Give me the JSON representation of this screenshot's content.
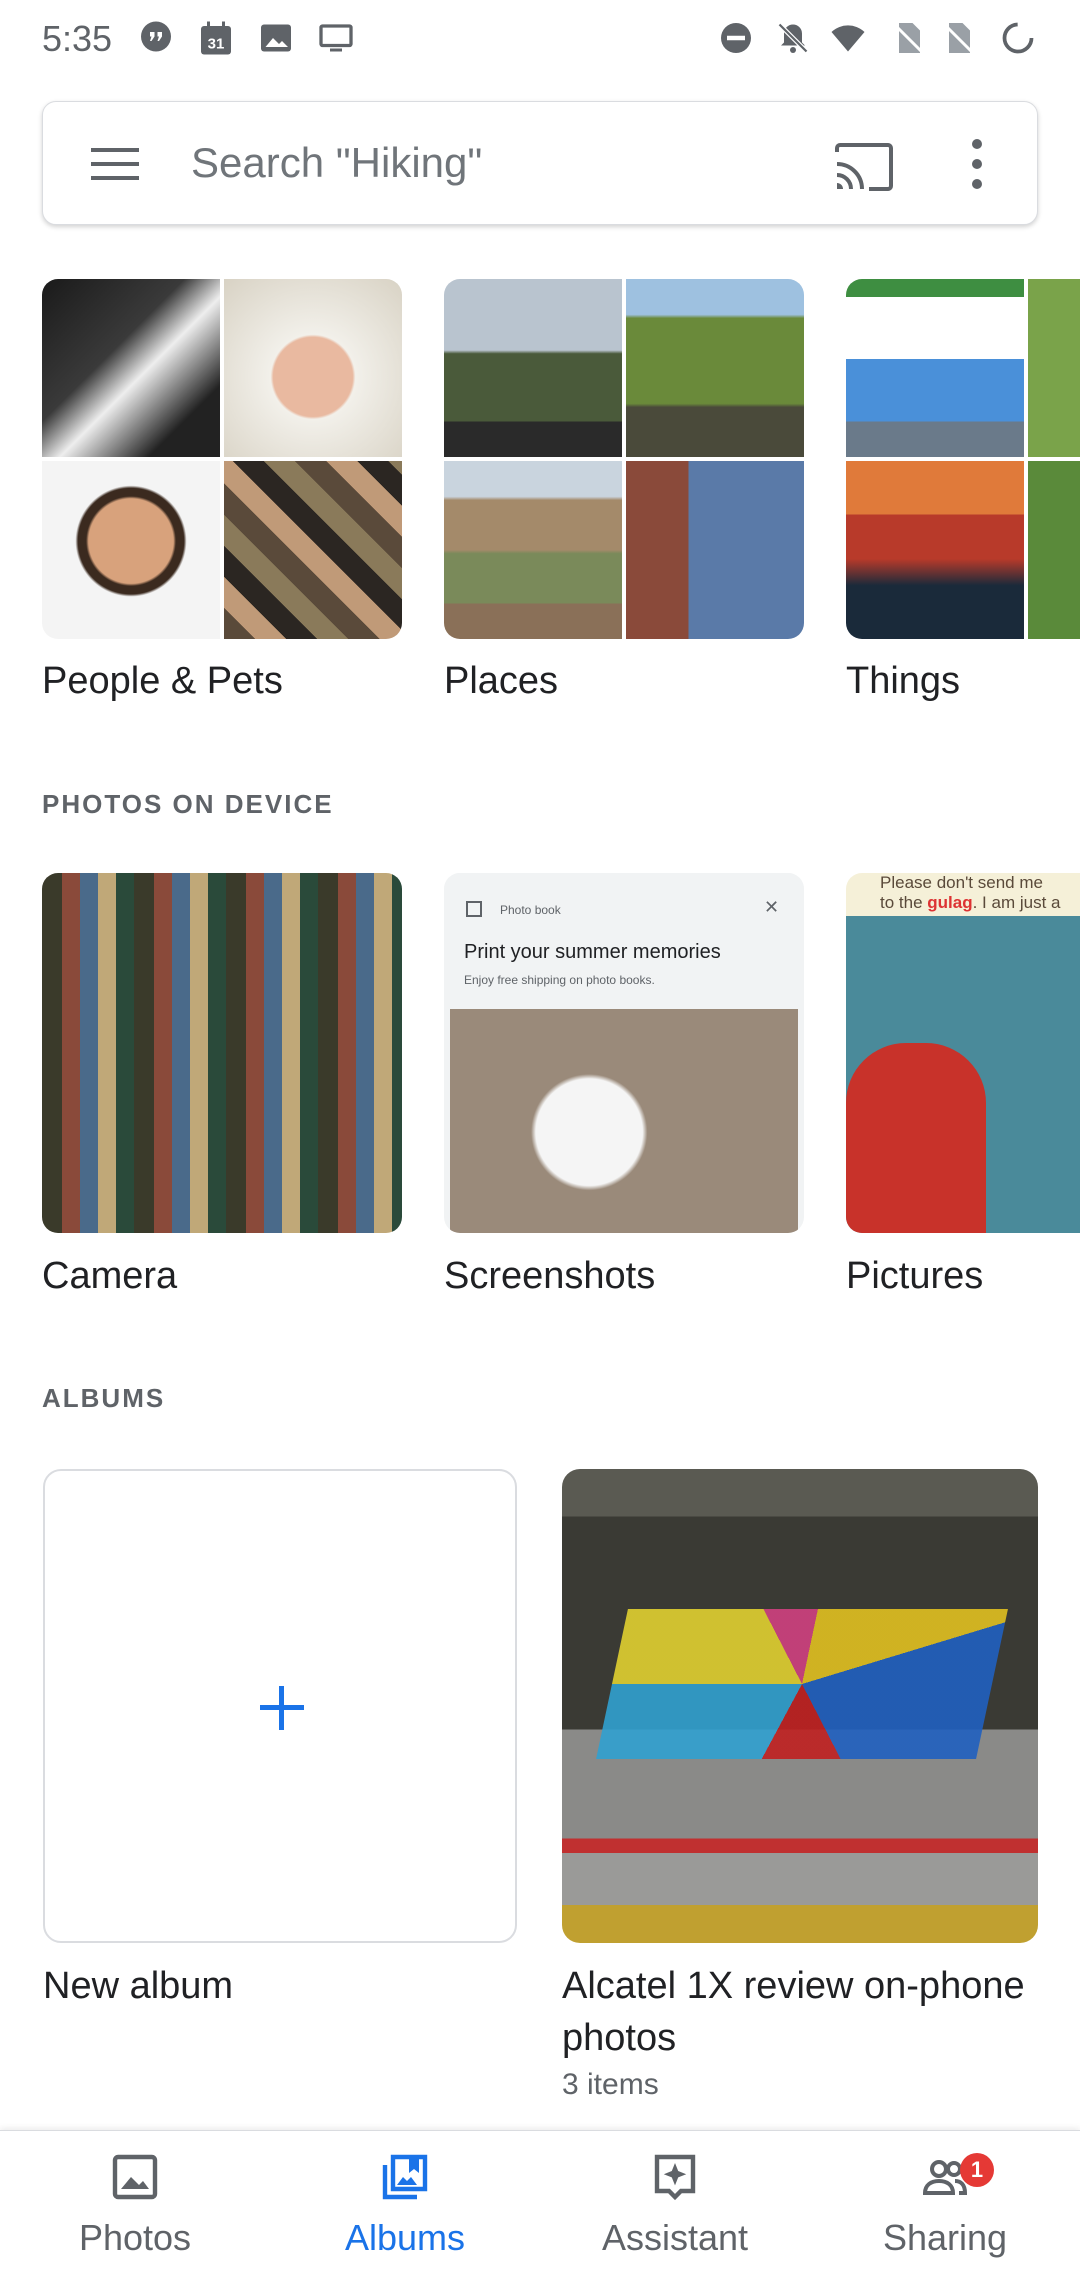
{
  "status_bar": {
    "time": "5:35",
    "left_icons": [
      "hangouts-icon",
      "calendar-icon",
      "image-icon",
      "cast-screen-icon"
    ],
    "calendar_day": "31",
    "right_icons": [
      "dnd-icon",
      "muted-bell-icon",
      "wifi-icon",
      "no-sim-icon",
      "no-sim-icon",
      "battery-icon"
    ]
  },
  "search": {
    "placeholder": "Search \"Hiking\""
  },
  "categories": [
    {
      "label": "People & Pets"
    },
    {
      "label": "Places"
    },
    {
      "label": "Things"
    }
  ],
  "device_section": {
    "header": "PHOTOS ON DEVICE",
    "folders": [
      {
        "label": "Camera"
      },
      {
        "label": "Screenshots"
      },
      {
        "label": "Pictures"
      }
    ],
    "screenshot_card": {
      "title": "Photo book",
      "heading": "Print your summer memories",
      "subtext": "Enjoy free shipping on photo books."
    },
    "pictures_text": {
      "line1": "Please don't send me",
      "line2_prefix": "to the ",
      "line2_highlight": "gulag",
      "line2_suffix": ". I am just a"
    }
  },
  "albums_section": {
    "header": "ALBUMS",
    "new_album_label": "New album",
    "albums": [
      {
        "title_line1": "Alcatel 1X review on-phone",
        "title_line2": "photos",
        "count": "3 items"
      }
    ]
  },
  "bottom_nav": {
    "items": [
      {
        "label": "Photos",
        "icon": "photo-icon",
        "active": false
      },
      {
        "label": "Albums",
        "icon": "albums-icon",
        "active": true
      },
      {
        "label": "Assistant",
        "icon": "assistant-icon",
        "active": false
      },
      {
        "label": "Sharing",
        "icon": "people-icon",
        "active": false,
        "badge": "1"
      }
    ]
  },
  "colors": {
    "accent": "#1a73e8",
    "badge": "#e53935",
    "text_secondary": "#5f6368"
  }
}
